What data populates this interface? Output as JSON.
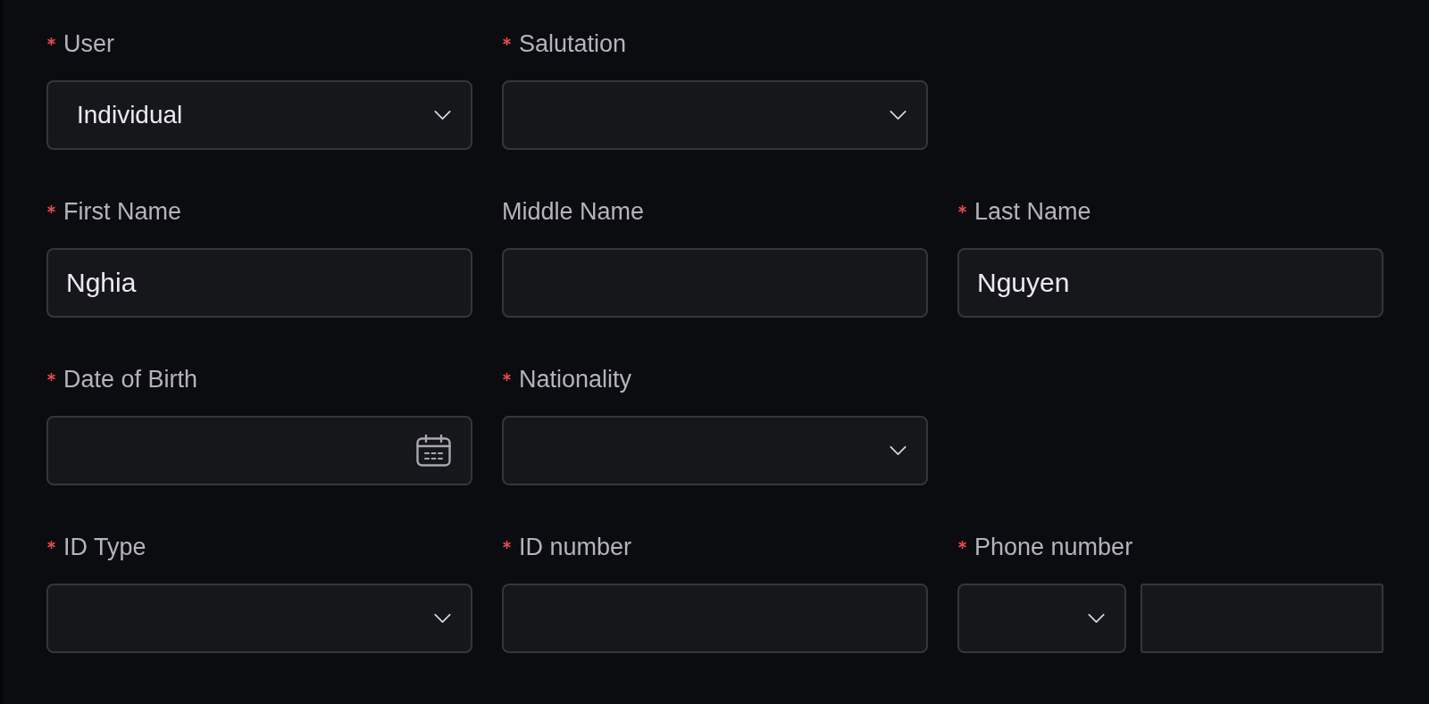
{
  "rows": [
    {
      "fields": [
        {
          "label": "User",
          "required": true,
          "kind": "select",
          "value": "Individual"
        },
        {
          "label": "Salutation",
          "required": true,
          "kind": "select"
        }
      ]
    },
    {
      "fields": [
        {
          "label": "First Name",
          "required": true,
          "kind": "text",
          "value": "Nghia"
        },
        {
          "label": "Middle Name",
          "required": false,
          "kind": "text"
        },
        {
          "label": "Last Name",
          "required": true,
          "kind": "text",
          "value": "Nguyen"
        }
      ]
    },
    {
      "fields": [
        {
          "label": "Date of Birth",
          "required": true,
          "kind": "date"
        },
        {
          "label": "Nationality",
          "required": true,
          "kind": "select"
        }
      ]
    },
    {
      "fields": [
        {
          "label": "ID Type",
          "required": true,
          "kind": "select"
        },
        {
          "label": "ID number",
          "required": true,
          "kind": "text"
        },
        {
          "label": "Phone number",
          "required": true,
          "kind": "phone"
        }
      ]
    }
  ]
}
